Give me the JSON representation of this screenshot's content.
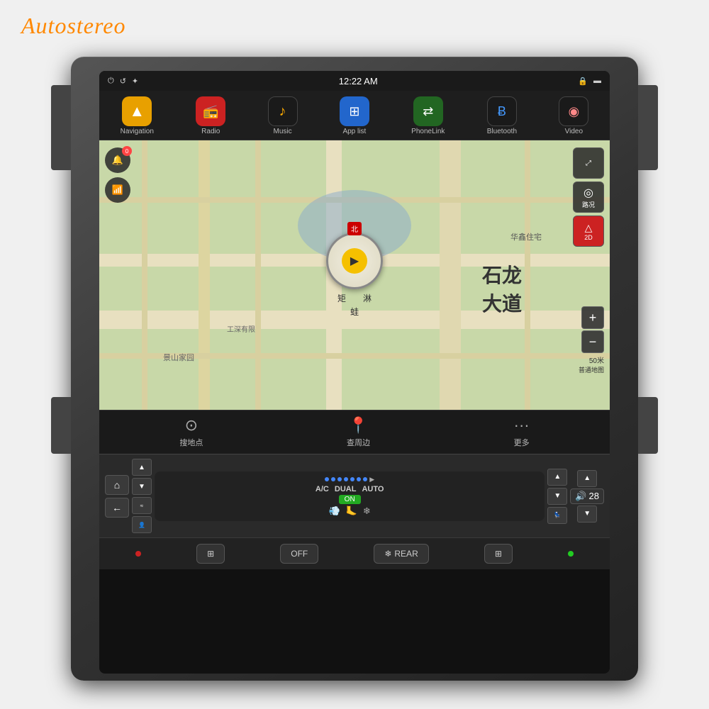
{
  "watermark": {
    "text": "Autostereo"
  },
  "status_bar": {
    "time": "12:22 AM",
    "icons_left": [
      "⏻",
      "↺",
      "✦"
    ],
    "icons_right": [
      "🔒",
      "🔋"
    ]
  },
  "app_bar": {
    "items": [
      {
        "id": "navigation",
        "label": "Navigation",
        "icon": "▲",
        "color": "nav"
      },
      {
        "id": "radio",
        "label": "Radio",
        "icon": "📻",
        "color": "radio"
      },
      {
        "id": "music",
        "label": "Music",
        "icon": "♪",
        "color": "music"
      },
      {
        "id": "applist",
        "label": "App list",
        "icon": "⊞",
        "color": "applist"
      },
      {
        "id": "phonelink",
        "label": "PhoneLink",
        "icon": "⇄",
        "color": "phonelink"
      },
      {
        "id": "bluetooth",
        "label": "Bluetooth",
        "icon": "Ƀ",
        "color": "bluetooth"
      },
      {
        "id": "video",
        "label": "Video",
        "icon": "◉",
        "color": "video"
      }
    ]
  },
  "map": {
    "left_controls": [
      {
        "id": "mute",
        "icon": "🔔",
        "badge": "0"
      },
      {
        "id": "wifi",
        "icon": "📶",
        "badge": null
      }
    ],
    "right_controls": [
      {
        "id": "fullscreen",
        "icon": "⤢",
        "label": ""
      },
      {
        "id": "road",
        "icon": "◎",
        "label": "路况"
      },
      {
        "id": "view2d",
        "icon": "△",
        "label": "2D",
        "active": true
      }
    ],
    "zoom_plus": "+",
    "zoom_minus": "−",
    "scale_label": "50米",
    "compass_north": "北",
    "direction_labels": [
      "矩",
      "淋",
      "蛙"
    ],
    "bottom_buttons": [
      {
        "id": "search",
        "icon": "⊙",
        "label": "搜地点"
      },
      {
        "id": "nearby",
        "icon": "📍",
        "label": "查周边"
      },
      {
        "id": "more",
        "icon": "···",
        "label": "更多"
      }
    ]
  },
  "climate": {
    "ac_label": "A/C",
    "dual_label": "DUAL",
    "auto_label": "AUTO",
    "on_label": "ON",
    "indicators": [
      1,
      1,
      1,
      1,
      1,
      1,
      1,
      1,
      1
    ],
    "fan_icon": "💨",
    "seat_icons": [
      "💺",
      "👤"
    ],
    "home_icon": "⌂",
    "back_icon": "←"
  },
  "volume": {
    "icon": "🔊",
    "level": "28"
  },
  "bottom_controls": {
    "buttons": [
      "·",
      "⊞",
      "OFF",
      "❄ REAR",
      "⊞",
      "·"
    ]
  }
}
